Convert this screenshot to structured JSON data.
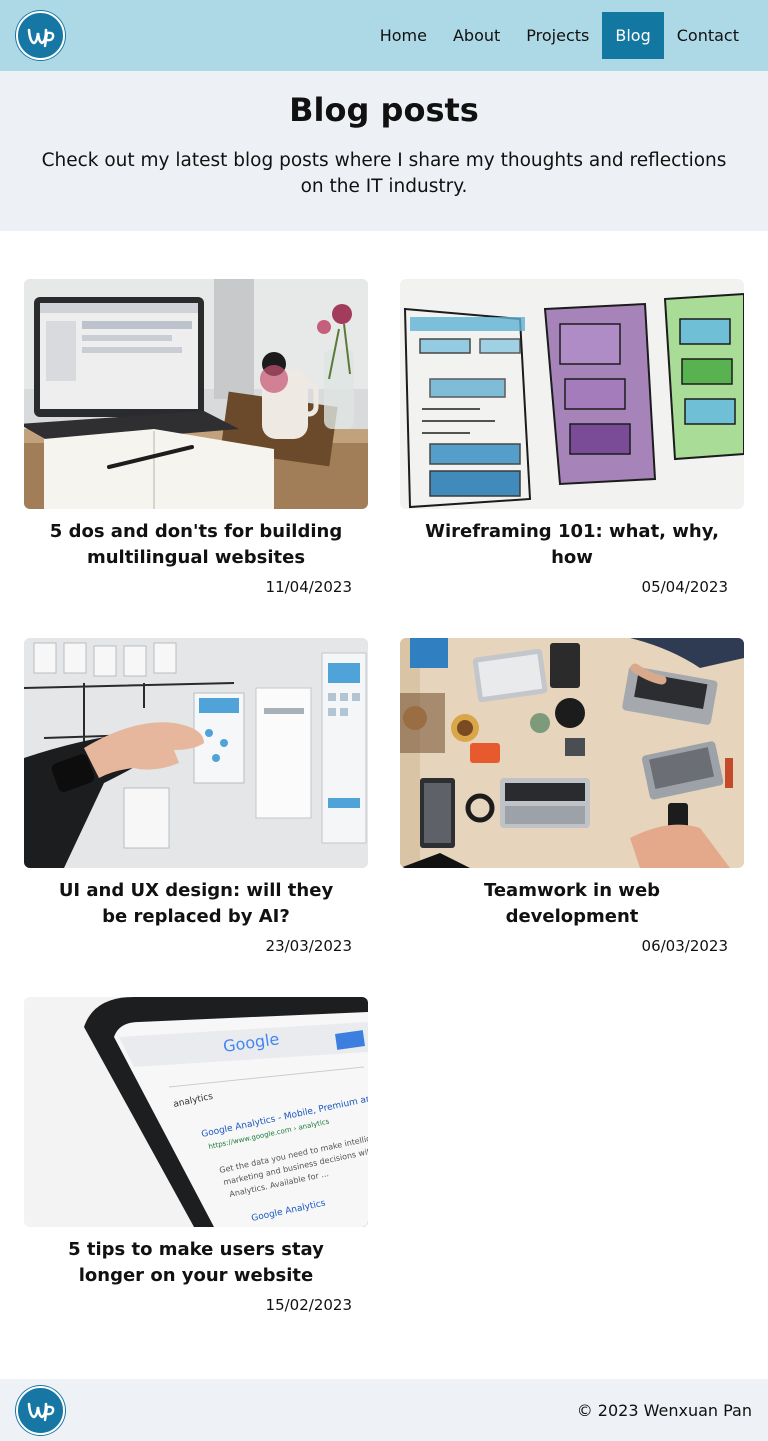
{
  "header": {
    "logo_text": "WP",
    "nav": [
      {
        "label": "Home",
        "active": false
      },
      {
        "label": "About",
        "active": false
      },
      {
        "label": "Projects",
        "active": false
      },
      {
        "label": "Blog",
        "active": true
      },
      {
        "label": "Contact",
        "active": false
      }
    ]
  },
  "hero": {
    "title": "Blog posts",
    "subtitle": "Check out my latest blog posts where I share my thoughts and reflections on the IT industry."
  },
  "posts": [
    {
      "title": "5 dos and don'ts for building multilingual websites",
      "date": "11/04/2023",
      "image": "laptop-desk-photo"
    },
    {
      "title": "Wireframing 101: what, why, how",
      "date": "05/04/2023",
      "image": "wireframe-sketch-photo"
    },
    {
      "title": "UI and UX design: will they be replaced by AI?",
      "date": "23/03/2023",
      "image": "ux-wall-photo"
    },
    {
      "title": "Teamwork in web development",
      "date": "06/03/2023",
      "image": "team-desk-photo"
    },
    {
      "title": "5 tips to make users stay longer on your website",
      "date": "15/02/2023",
      "image": "phone-search-photo"
    }
  ],
  "footer": {
    "copyright": "© 2023 Wenxuan Pan",
    "logo_text": "WP"
  },
  "colors": {
    "header_bg": "#add8e6",
    "nav_active_bg": "#1277a1",
    "hero_bg": "#edf1f6",
    "footer_bg": "#eef1f6",
    "brand": "#1677a4"
  }
}
